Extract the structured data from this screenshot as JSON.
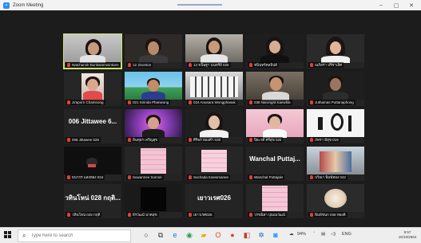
{
  "window": {
    "title": "Zoom Meeting",
    "minimize": "–",
    "maximize": "▢",
    "close": "✕"
  },
  "participants": [
    {
      "name": "Natchanok Bunkasemsinkorn",
      "big_name": ""
    },
    {
      "name": "12 Jinonton",
      "big_name": ""
    },
    {
      "name": "13 ขนิษฐา นนทรีย์ 026",
      "big_name": ""
    },
    {
      "name": "ชนินทร์คลธิปต์",
      "big_name": ""
    },
    {
      "name": "ณภิสรา ปรีชาเลิศ",
      "big_name": ""
    },
    {
      "name": "Jiraporn Chamnong",
      "big_name": ""
    },
    {
      "name": "021 Sirinda Phanwong",
      "big_name": ""
    },
    {
      "name": "024 Anusara Wongphasuk",
      "big_name": ""
    },
    {
      "name": "038 Narongrit Kaewkla",
      "big_name": ""
    },
    {
      "name": "Juthamas Puttanaphong",
      "big_name": ""
    },
    {
      "name": "006 Jittawee 025",
      "big_name": "006 Jittawee 6..."
    },
    {
      "name": "อินทุอร เจริญสุข",
      "big_name": ""
    },
    {
      "name": "ศิริพร ทองคำ 030",
      "big_name": ""
    },
    {
      "name": "ปิยะวดี ศรีสุข 025",
      "big_name": ""
    },
    {
      "name": "ภัทรา มีสุข 019",
      "big_name": ""
    },
    {
      "name": "ธนากร แสงทอง 034",
      "big_name": ""
    },
    {
      "name": "Suwannee Somsri",
      "big_name": ""
    },
    {
      "name": "Suchada Kaewmanee",
      "big_name": ""
    },
    {
      "name": "Wanchal Puttajakr",
      "big_name": "Wanchal Puttaj..."
    },
    {
      "name": "ปวีณา พิมพ์ทอง 042",
      "big_name": ""
    },
    {
      "name": "วทินโหน่ 028 กฤติ",
      "big_name": "วทินโหน่ 028 กฤติ..."
    },
    {
      "name": "ธีรวัฒน์ นาคสุข",
      "big_name": ""
    },
    {
      "name": "เยาวเรศ026",
      "big_name": "เยาวเรศ026"
    },
    {
      "name": "วรรณิสา ปุณณวัฒน์",
      "big_name": ""
    },
    {
      "name": "พิมพ์ชนก 036 ทองดี",
      "big_name": ""
    }
  ],
  "taskbar": {
    "search_placeholder": "Type here to search",
    "battery": "94%",
    "time": "9:57",
    "date": "16/10/2564"
  },
  "colors": {
    "active_border": "#c8e36b",
    "mic_muted": "#e0403a",
    "meeting_bg": "#1c1c1c"
  }
}
